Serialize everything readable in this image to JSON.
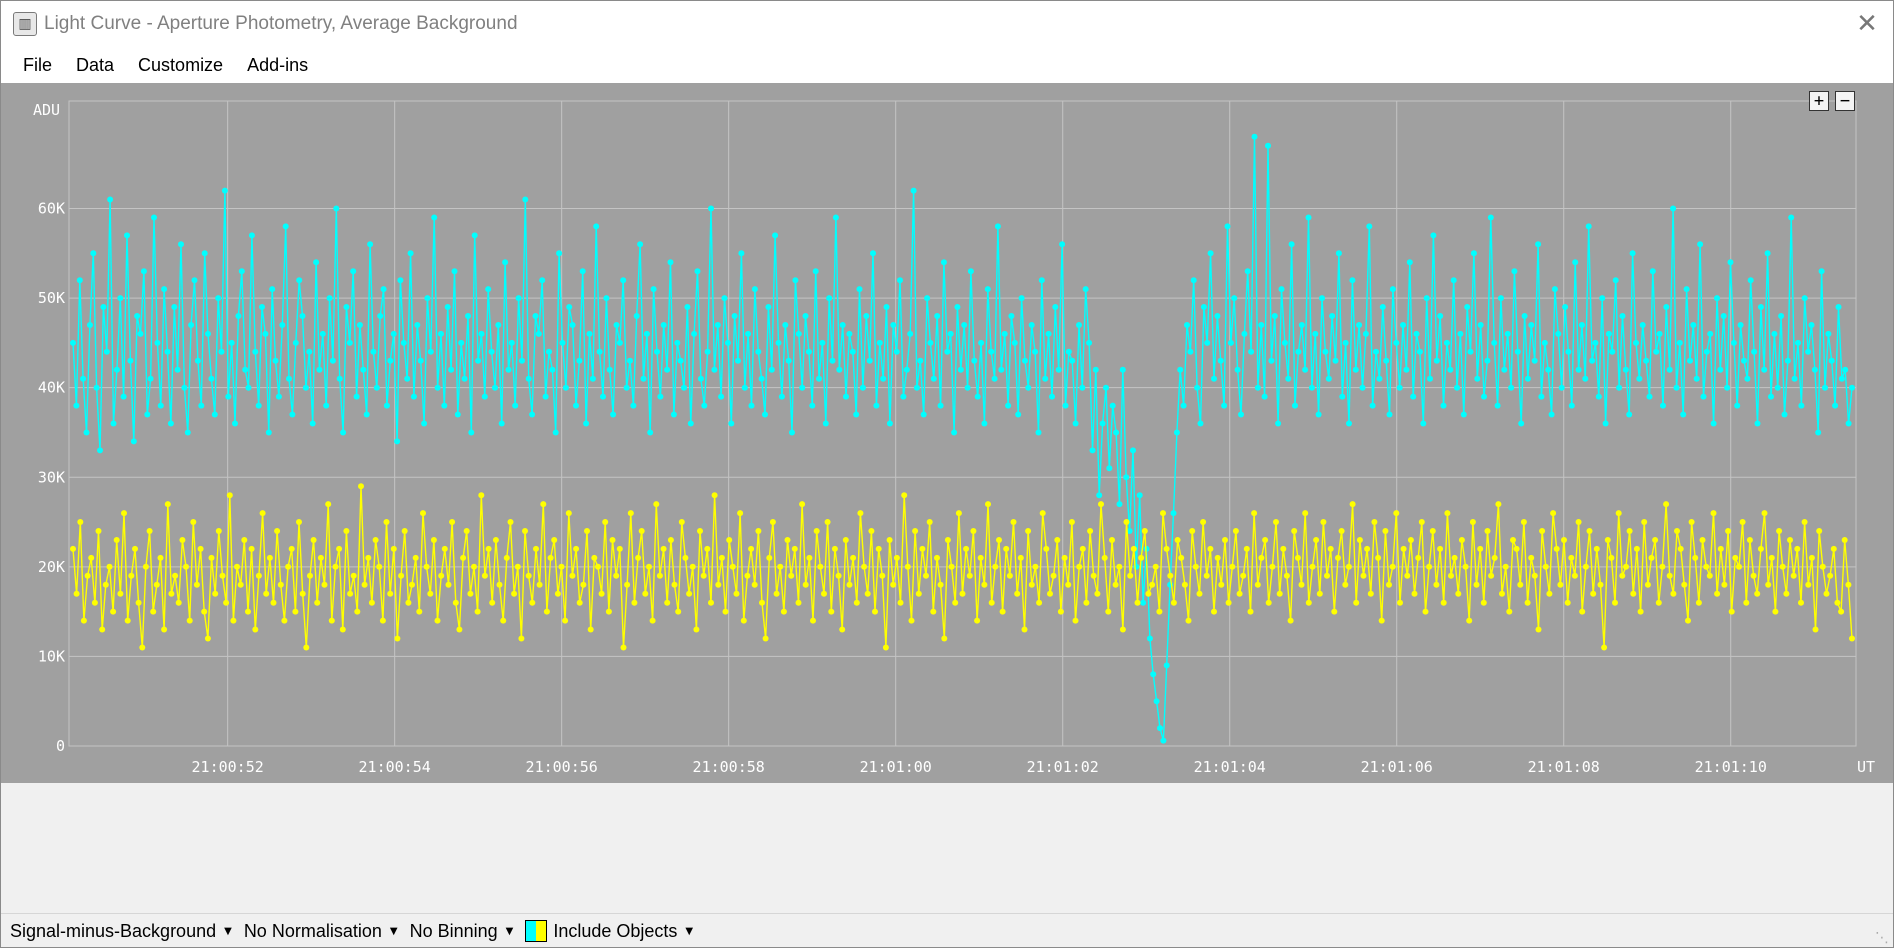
{
  "window": {
    "title": "Light Curve - Aperture Photometry, Average Background",
    "app_icon": "chart-bars-icon",
    "close": "✕"
  },
  "menu": [
    "File",
    "Data",
    "Customize",
    "Add-ins"
  ],
  "zoom": {
    "in": "+",
    "out": "−"
  },
  "status": {
    "mode": "Signal-minus-Background",
    "normalisation": "No Normalisation",
    "binning": "No Binning",
    "objects": "Include Objects",
    "swatch_colors": [
      "#00ffff",
      "#ffff00"
    ]
  },
  "colors": {
    "plot_bg": "#a0a0a0",
    "grid": "#c4c4c4",
    "series1": "#00ffff",
    "series2": "#ffff00",
    "axis_text": "#ffffff"
  },
  "chart_data": {
    "type": "line",
    "ylabel": "ADU",
    "xlabel": "UT",
    "ylim": [
      0,
      72000
    ],
    "xlim": [
      "21:00:50.1",
      "21:01:11.5"
    ],
    "yticks": [
      "0",
      "10K",
      "20K",
      "30K",
      "40K",
      "50K",
      "60K"
    ],
    "xticks": [
      "21:00:52",
      "21:00:54",
      "21:00:56",
      "21:00:58",
      "21:01:00",
      "21:01:02",
      "21:01:04",
      "21:01:06",
      "21:01:08",
      "21:01:10"
    ],
    "grid": true,
    "series": [
      {
        "color": "#00ffff",
        "values": [
          45000,
          38000,
          52000,
          41000,
          35000,
          47000,
          55000,
          40000,
          33000,
          49000,
          44000,
          61000,
          36000,
          42000,
          50000,
          39000,
          57000,
          43000,
          34000,
          48000,
          46000,
          53000,
          37000,
          41000,
          59000,
          45000,
          38000,
          51000,
          44000,
          36000,
          49000,
          42000,
          56000,
          40000,
          35000,
          47000,
          52000,
          43000,
          38000,
          55000,
          46000,
          41000,
          37000,
          50000,
          44000,
          62000,
          39000,
          45000,
          36000,
          48000,
          53000,
          42000,
          40000,
          57000,
          44000,
          38000,
          49000,
          46000,
          35000,
          51000,
          43000,
          39000,
          47000,
          58000,
          41000,
          37000,
          45000,
          52000,
          48000,
          40000,
          44000,
          36000,
          54000,
          42000,
          46000,
          38000,
          50000,
          43000,
          60000,
          41000,
          35000,
          49000,
          45000,
          53000,
          39000,
          47000,
          42000,
          37000,
          56000,
          44000,
          40000,
          48000,
          51000,
          38000,
          43000,
          46000,
          34000,
          52000,
          45000,
          41000,
          55000,
          39000,
          47000,
          43000,
          36000,
          50000,
          44000,
          59000,
          40000,
          46000,
          38000,
          49000,
          42000,
          53000,
          37000,
          45000,
          41000,
          48000,
          35000,
          57000,
          43000,
          46000,
          39000,
          51000,
          44000,
          40000,
          47000,
          36000,
          54000,
          42000,
          45000,
          38000,
          50000,
          43000,
          61000,
          41000,
          37000,
          48000,
          46000,
          52000,
          39000,
          44000,
          42000,
          35000,
          55000,
          45000,
          40000,
          49000,
          47000,
          38000,
          43000,
          53000,
          36000,
          46000,
          41000,
          58000,
          44000,
          39000,
          50000,
          42000,
          37000,
          47000,
          45000,
          52000,
          40000,
          43000,
          38000,
          48000,
          56000,
          41000,
          46000,
          35000,
          51000,
          44000,
          39000,
          47000,
          42000,
          54000,
          37000,
          45000,
          43000,
          40000,
          49000,
          36000,
          46000,
          53000,
          41000,
          38000,
          44000,
          60000,
          42000,
          47000,
          39000,
          50000,
          45000,
          36000,
          48000,
          43000,
          55000,
          40000,
          46000,
          38000,
          51000,
          44000,
          41000,
          37000,
          49000,
          42000,
          57000,
          45000,
          39000,
          47000,
          43000,
          35000,
          52000,
          46000,
          40000,
          48000,
          44000,
          38000,
          53000,
          41000,
          45000,
          36000,
          50000,
          43000,
          59000,
          42000,
          47000,
          39000,
          46000,
          44000,
          37000,
          51000,
          40000,
          48000,
          43000,
          55000,
          38000,
          45000,
          41000,
          49000,
          36000,
          47000,
          44000,
          52000,
          39000,
          42000,
          46000,
          62000,
          40000,
          43000,
          37000,
          50000,
          45000,
          41000,
          48000,
          38000,
          54000,
          44000,
          46000,
          35000,
          49000,
          42000,
          47000,
          40000,
          53000,
          43000,
          39000,
          45000,
          36000,
          51000,
          44000,
          41000,
          58000,
          42000,
          46000,
          38000,
          48000,
          45000,
          37000,
          50000,
          43000,
          40000,
          47000,
          44000,
          35000,
          52000,
          41000,
          46000,
          39000,
          49000,
          42000,
          56000,
          38000,
          44000,
          43000,
          36000,
          47000,
          40000,
          51000,
          45000,
          33000,
          42000,
          28000,
          36000,
          40000,
          31000,
          38000,
          35000,
          27000,
          42000,
          30000,
          24000,
          33000,
          20000,
          28000,
          16000,
          22000,
          12000,
          8000,
          5000,
          2000,
          600,
          9000,
          18000,
          26000,
          35000,
          42000,
          38000,
          47000,
          44000,
          52000,
          40000,
          36000,
          49000,
          45000,
          55000,
          41000,
          48000,
          43000,
          38000,
          58000,
          45000,
          50000,
          42000,
          37000,
          46000,
          53000,
          44000,
          68000,
          40000,
          47000,
          39000,
          67000,
          43000,
          48000,
          36000,
          51000,
          45000,
          41000,
          56000,
          38000,
          44000,
          47000,
          42000,
          59000,
          40000,
          46000,
          37000,
          50000,
          44000,
          41000,
          48000,
          43000,
          55000,
          39000,
          45000,
          36000,
          52000,
          42000,
          47000,
          40000,
          46000,
          58000,
          38000,
          44000,
          41000,
          49000,
          43000,
          37000,
          51000,
          45000,
          40000,
          47000,
          42000,
          54000,
          39000,
          46000,
          44000,
          36000,
          50000,
          41000,
          57000,
          43000,
          48000,
          38000,
          45000,
          42000,
          52000,
          40000,
          46000,
          37000,
          49000,
          44000,
          55000,
          41000,
          47000,
          39000,
          43000,
          59000,
          45000,
          38000,
          50000,
          42000,
          46000,
          40000,
          53000,
          44000,
          36000,
          48000,
          41000,
          47000,
          43000,
          56000,
          39000,
          45000,
          42000,
          37000,
          51000,
          46000,
          40000,
          49000,
          44000,
          38000,
          54000,
          42000,
          47000,
          41000,
          58000,
          43000,
          45000,
          39000,
          50000,
          36000,
          46000,
          44000,
          52000,
          40000,
          48000,
          42000,
          37000,
          55000,
          45000,
          41000,
          47000,
          43000,
          39000,
          53000,
          44000,
          46000,
          38000,
          49000,
          42000,
          60000,
          40000,
          45000,
          37000,
          51000,
          43000,
          47000,
          41000,
          56000,
          39000,
          44000,
          46000,
          36000,
          50000,
          42000,
          48000,
          40000,
          54000,
          45000,
          38000,
          47000,
          43000,
          41000,
          52000,
          44000,
          36000,
          49000,
          42000,
          55000,
          39000,
          46000,
          40000,
          48000,
          37000,
          43000,
          59000,
          41000,
          45000,
          38000,
          50000,
          44000,
          47000,
          42000,
          35000,
          53000,
          40000,
          46000,
          43000,
          38000,
          49000,
          41000,
          42000,
          36000,
          40000
        ]
      },
      {
        "color": "#ffff00",
        "values": [
          22000,
          17000,
          25000,
          14000,
          19000,
          21000,
          16000,
          24000,
          13000,
          18000,
          20000,
          15000,
          23000,
          17000,
          26000,
          14000,
          19000,
          22000,
          16000,
          11000,
          20000,
          24000,
          15000,
          18000,
          21000,
          13000,
          27000,
          17000,
          19000,
          16000,
          23000,
          20000,
          14000,
          25000,
          18000,
          22000,
          15000,
          12000,
          21000,
          17000,
          24000,
          19000,
          16000,
          28000,
          14000,
          20000,
          18000,
          23000,
          15000,
          22000,
          13000,
          19000,
          26000,
          17000,
          21000,
          16000,
          24000,
          18000,
          14000,
          20000,
          22000,
          15000,
          25000,
          17000,
          11000,
          19000,
          23000,
          16000,
          21000,
          18000,
          27000,
          14000,
          20000,
          22000,
          13000,
          24000,
          17000,
          19000,
          15000,
          29000,
          18000,
          21000,
          16000,
          23000,
          20000,
          14000,
          25000,
          17000,
          22000,
          12000,
          19000,
          24000,
          16000,
          18000,
          21000,
          15000,
          26000,
          20000,
          17000,
          23000,
          14000,
          19000,
          22000,
          18000,
          25000,
          16000,
          13000,
          21000,
          24000,
          17000,
          20000,
          15000,
          28000,
          19000,
          22000,
          16000,
          23000,
          18000,
          14000,
          21000,
          25000,
          17000,
          20000,
          12000,
          24000,
          19000,
          16000,
          22000,
          18000,
          27000,
          15000,
          21000,
          23000,
          17000,
          20000,
          14000,
          26000,
          19000,
          22000,
          16000,
          18000,
          24000,
          13000,
          21000,
          20000,
          17000,
          25000,
          15000,
          23000,
          19000,
          22000,
          11000,
          18000,
          26000,
          16000,
          21000,
          24000,
          17000,
          20000,
          14000,
          27000,
          19000,
          22000,
          16000,
          23000,
          18000,
          15000,
          25000,
          21000,
          17000,
          20000,
          13000,
          24000,
          19000,
          22000,
          16000,
          28000,
          18000,
          21000,
          15000,
          23000,
          20000,
          17000,
          26000,
          14000,
          19000,
          22000,
          18000,
          24000,
          16000,
          12000,
          21000,
          25000,
          17000,
          20000,
          15000,
          23000,
          19000,
          22000,
          16000,
          27000,
          18000,
          21000,
          14000,
          24000,
          20000,
          17000,
          25000,
          15000,
          22000,
          19000,
          13000,
          23000,
          18000,
          21000,
          16000,
          26000,
          20000,
          17000,
          24000,
          15000,
          22000,
          19000,
          11000,
          23000,
          18000,
          21000,
          16000,
          28000,
          20000,
          14000,
          24000,
          17000,
          22000,
          19000,
          25000,
          15000,
          21000,
          18000,
          12000,
          23000,
          20000,
          16000,
          26000,
          17000,
          22000,
          19000,
          24000,
          14000,
          21000,
          18000,
          27000,
          16000,
          20000,
          23000,
          15000,
          22000,
          19000,
          25000,
          17000,
          21000,
          13000,
          24000,
          18000,
          20000,
          16000,
          26000,
          22000,
          17000,
          19000,
          23000,
          15000,
          21000,
          18000,
          25000,
          14000,
          20000,
          22000,
          16000,
          24000,
          19000,
          17000,
          27000,
          21000,
          15000,
          23000,
          18000,
          20000,
          13000,
          25000,
          19000,
          22000,
          16000,
          21000,
          24000,
          17000,
          18000,
          20000,
          15000,
          26000,
          22000,
          19000,
          16000,
          23000,
          21000,
          18000,
          14000,
          24000,
          20000,
          17000,
          25000,
          19000,
          22000,
          15000,
          21000,
          18000,
          23000,
          16000,
          20000,
          24000,
          17000,
          19000,
          22000,
          15000,
          26000,
          18000,
          21000,
          23000,
          16000,
          20000,
          25000,
          17000,
          22000,
          19000,
          14000,
          24000,
          21000,
          18000,
          26000,
          16000,
          20000,
          23000,
          17000,
          25000,
          19000,
          22000,
          15000,
          21000,
          24000,
          18000,
          20000,
          27000,
          16000,
          23000,
          19000,
          22000,
          17000,
          25000,
          21000,
          14000,
          24000,
          18000,
          20000,
          26000,
          16000,
          22000,
          19000,
          23000,
          17000,
          21000,
          25000,
          15000,
          20000,
          24000,
          18000,
          22000,
          16000,
          26000,
          19000,
          21000,
          17000,
          23000,
          20000,
          14000,
          25000,
          18000,
          22000,
          16000,
          24000,
          19000,
          21000,
          27000,
          17000,
          20000,
          15000,
          23000,
          22000,
          18000,
          25000,
          16000,
          21000,
          19000,
          13000,
          24000,
          20000,
          17000,
          26000,
          22000,
          18000,
          23000,
          16000,
          21000,
          19000,
          25000,
          15000,
          20000,
          24000,
          17000,
          22000,
          18000,
          11000,
          23000,
          21000,
          16000,
          26000,
          19000,
          20000,
          24000,
          17000,
          22000,
          15000,
          25000,
          18000,
          21000,
          23000,
          16000,
          20000,
          27000,
          19000,
          17000,
          24000,
          22000,
          18000,
          14000,
          25000,
          21000,
          16000,
          23000,
          20000,
          19000,
          26000,
          17000,
          22000,
          18000,
          24000,
          15000,
          21000,
          20000,
          25000,
          16000,
          23000,
          19000,
          17000,
          22000,
          26000,
          18000,
          21000,
          15000,
          24000,
          20000,
          17000,
          23000,
          19000,
          22000,
          16000,
          25000,
          18000,
          21000,
          13000,
          24000,
          20000,
          17000,
          19000,
          22000,
          16000,
          15000,
          23000,
          18000,
          12000
        ]
      }
    ]
  }
}
